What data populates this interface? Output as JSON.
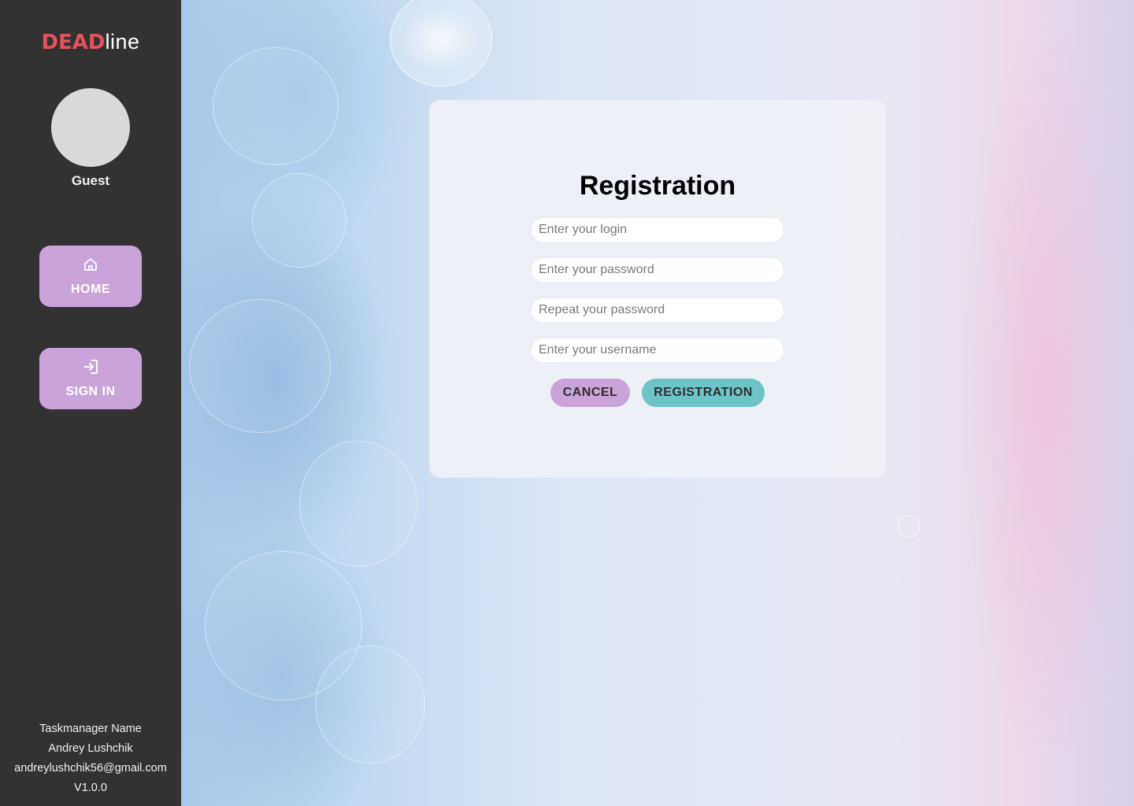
{
  "app": {
    "logo_dead": "DEAD",
    "logo_line": "line"
  },
  "user": {
    "name": "Guest"
  },
  "nav": {
    "home_label": "HOME",
    "home_icon": "home-icon",
    "signin_label": "SIGN IN",
    "signin_icon": "sign-in-icon"
  },
  "footer": {
    "app_name": "Taskmanager Name",
    "author": "Andrey Lushchik",
    "email": "andreylushchik56@gmail.com",
    "version": "V1.0.0"
  },
  "form": {
    "title": "Registration",
    "login_placeholder": "Enter your login",
    "password_placeholder": "Enter your password",
    "repeat_password_placeholder": "Repeat your password",
    "username_placeholder": "Enter your username",
    "cancel_label": "CANCEL",
    "submit_label": "REGISTRATION"
  },
  "colors": {
    "sidebar": "#323232",
    "accent_purple": "#c9a3d9",
    "accent_teal": "#6cc4c7",
    "logo_red": "#e5525b"
  }
}
